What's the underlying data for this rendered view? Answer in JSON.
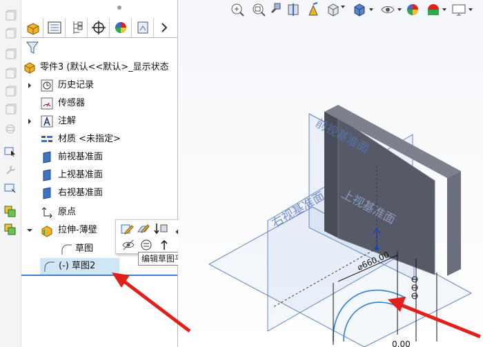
{
  "feature_tree": {
    "root_label": "零件3 (默认<<默认>_显示状态",
    "items": [
      {
        "label": "历史记录",
        "icon": "history-icon",
        "expandable": true
      },
      {
        "label": "传感器",
        "icon": "sensor-icon",
        "expandable": false
      },
      {
        "label": "注解",
        "icon": "annotation-icon",
        "expandable": true
      },
      {
        "label": "材质 <未指定>",
        "icon": "material-icon",
        "expandable": false
      },
      {
        "label": "前视基准面",
        "icon": "plane-icon",
        "expandable": false
      },
      {
        "label": "上视基准面",
        "icon": "plane-icon",
        "expandable": false
      },
      {
        "label": "右视基准面",
        "icon": "plane-icon",
        "expandable": false
      },
      {
        "label": "原点",
        "icon": "origin-icon",
        "expandable": false
      },
      {
        "label": "拉伸-薄壁",
        "icon": "extrude-icon",
        "expandable": true
      }
    ],
    "child_sketch_label": "草图",
    "selected_sketch_label": "(-) 草图2"
  },
  "context_popup": {
    "tooltip": "编辑草图平面"
  },
  "viewport": {
    "plane_labels": {
      "front": "前视基准面",
      "top": "上视基准面",
      "right": "右视基准面"
    },
    "dimension_diameter": "⌀660.00",
    "dimension_partial": "0.00"
  },
  "colors": {
    "selection": "#cfe6f7",
    "arrow": "#e0201b",
    "plane_line": "#5b84c9",
    "sketch": "#2f7fd8",
    "body_front": "#555a66"
  }
}
